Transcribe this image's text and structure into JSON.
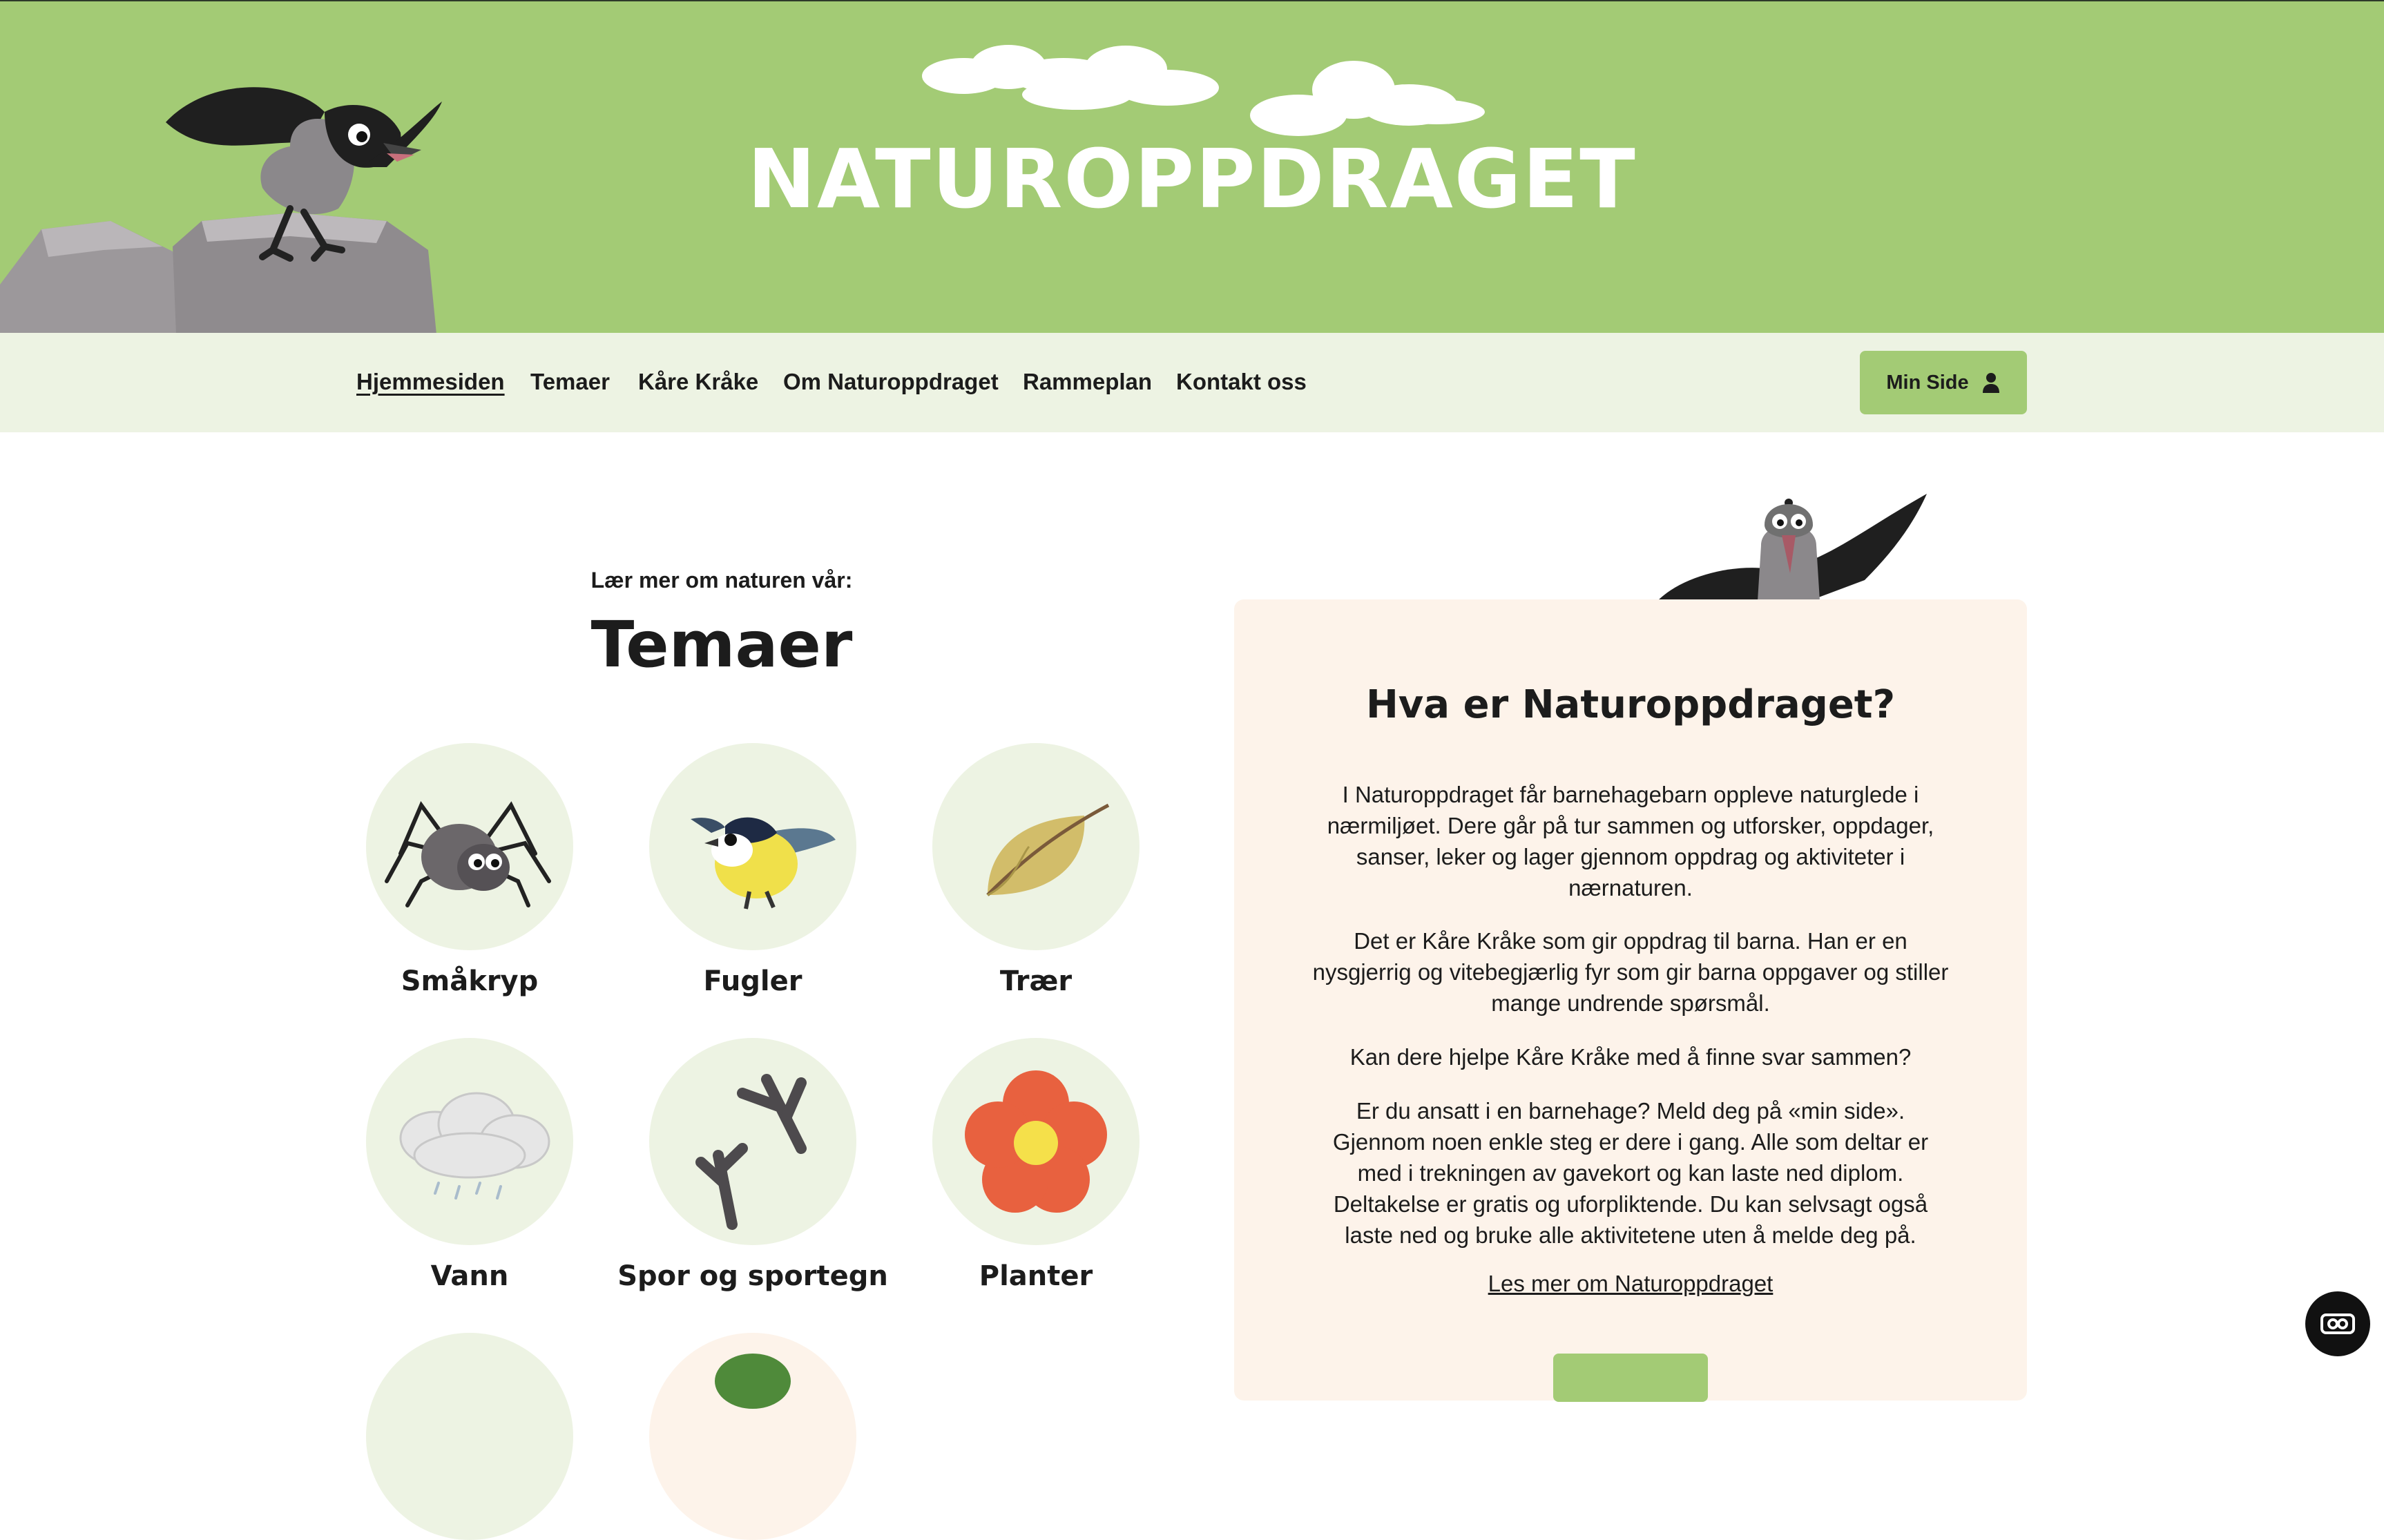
{
  "site": {
    "logo_text": "NATUROPPDRAGET",
    "colors": {
      "hero_green": "#a3cb75",
      "nav_bg": "#edf3e3",
      "card_bg": "#fdf3ea",
      "text": "#1c1c1c"
    }
  },
  "nav": {
    "items": [
      {
        "label": "Hjemmesiden",
        "active": true
      },
      {
        "label": "Temaer"
      },
      {
        "label": "Kåre Kråke"
      },
      {
        "label": "Om Naturoppdraget"
      },
      {
        "label": "Rammeplan"
      },
      {
        "label": "Kontakt oss"
      }
    ],
    "min_side": {
      "label": "Min Side",
      "icon": "person-icon"
    }
  },
  "themes": {
    "eyebrow": "Lær mer om naturen vår:",
    "title": "Temaer",
    "items": [
      {
        "label": "Småkryp",
        "icon": "spider-icon"
      },
      {
        "label": "Fugler",
        "icon": "bird-icon"
      },
      {
        "label": "Trær",
        "icon": "leaf-icon"
      },
      {
        "label": "Vann",
        "icon": "rain-cloud-icon"
      },
      {
        "label": "Spor og sportegn",
        "icon": "tracks-icon"
      },
      {
        "label": "Planter",
        "icon": "flower-icon"
      }
    ]
  },
  "info": {
    "title": "Hva er Naturoppdraget?",
    "paragraphs": [
      "I Naturoppdraget får barnehagebarn oppleve naturglede i nærmiljøet. Dere går på tur sammen og utforsker, oppdager, sanser, leker og lager gjennom oppdrag og aktiviteter i nærnaturen.",
      "Det er Kåre Kråke som gir oppdrag til barna. Han er en nysgjerrig og vitebegjærlig fyr som gir barna oppgaver og stiller mange undrende spørsmål.",
      "Kan dere hjelpe Kåre Kråke med å finne svar sammen?",
      "Er du ansatt i en barnehage? Meld deg på «min side». Gjennom noen enkle steg er dere i gang. Alle som deltar er med i trekningen av gavekort og kan laste ned diplom. Deltakelse er gratis og uforpliktende. Du kan selvsagt også laste ned og bruke alle aktivitetene uten å melde deg på."
    ],
    "link": "Les mer om Naturoppdraget"
  },
  "chat": {
    "icon": "chat-icon"
  }
}
